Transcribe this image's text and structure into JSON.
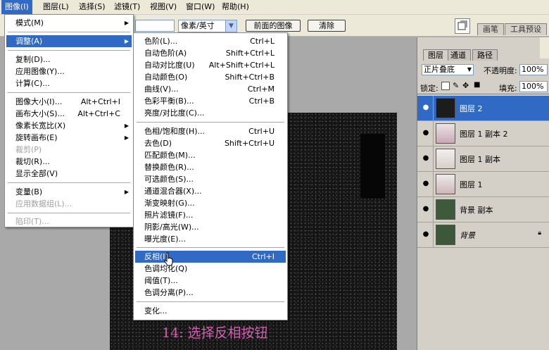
{
  "menubar": {
    "items": [
      {
        "label": "图像(I)"
      },
      {
        "label": "图层(L)"
      },
      {
        "label": "选择(S)"
      },
      {
        "label": "滤镜(T)"
      },
      {
        "label": "视图(V)"
      },
      {
        "label": "窗口(W)"
      },
      {
        "label": "帮助(H)"
      }
    ]
  },
  "options_bar": {
    "unit_select": "像素/英寸",
    "front_image_button": "前面的图像",
    "clear_button": "清除",
    "palette_tabs": [
      "画笔",
      "工具预设"
    ]
  },
  "image_menu": {
    "items": [
      {
        "label": "模式(M)",
        "shortcut": "",
        "submenu": true,
        "disabled": false
      },
      {
        "label": "调整(A)",
        "shortcut": "",
        "submenu": true,
        "disabled": false,
        "highlighted": true
      },
      {
        "label": "复制(D)...",
        "shortcut": "",
        "disabled": false
      },
      {
        "label": "应用图像(Y)...",
        "shortcut": "",
        "disabled": false
      },
      {
        "label": "计算(C)...",
        "shortcut": "",
        "disabled": false
      },
      {
        "label": "图像大小(I)...",
        "shortcut": "Alt+Ctrl+I",
        "disabled": false
      },
      {
        "label": "画布大小(S)...",
        "shortcut": "Alt+Ctrl+C",
        "disabled": false
      },
      {
        "label": "像素长宽比(X)",
        "shortcut": "",
        "submenu": true,
        "disabled": false
      },
      {
        "label": "旋转画布(E)",
        "shortcut": "",
        "submenu": true,
        "disabled": false
      },
      {
        "label": "裁剪(P)",
        "shortcut": "",
        "disabled": true
      },
      {
        "label": "裁切(R)...",
        "shortcut": "",
        "disabled": false
      },
      {
        "label": "显示全部(V)",
        "shortcut": "",
        "disabled": false
      },
      {
        "label": "变量(B)",
        "shortcut": "",
        "submenu": true,
        "disabled": false
      },
      {
        "label": "应用数据组(L)...",
        "shortcut": "",
        "disabled": true
      },
      {
        "label": "陷印(T)...",
        "shortcut": "",
        "disabled": true
      }
    ]
  },
  "adjust_menu": {
    "items": [
      {
        "label": "色阶(L)...",
        "shortcut": "Ctrl+L"
      },
      {
        "label": "自动色阶(A)",
        "shortcut": "Shift+Ctrl+L"
      },
      {
        "label": "自动对比度(U)",
        "shortcut": "Alt+Shift+Ctrl+L"
      },
      {
        "label": "自动颜色(O)",
        "shortcut": "Shift+Ctrl+B"
      },
      {
        "label": "曲线(V)...",
        "shortcut": "Ctrl+M"
      },
      {
        "label": "色彩平衡(B)...",
        "shortcut": "Ctrl+B"
      },
      {
        "label": "亮度/对比度(C)...",
        "shortcut": ""
      },
      {
        "label": "色相/饱和度(H)...",
        "shortcut": "Ctrl+U"
      },
      {
        "label": "去色(D)",
        "shortcut": "Shift+Ctrl+U"
      },
      {
        "label": "匹配颜色(M)...",
        "shortcut": ""
      },
      {
        "label": "替换颜色(R)...",
        "shortcut": ""
      },
      {
        "label": "可选颜色(S)...",
        "shortcut": ""
      },
      {
        "label": "通道混合器(X)...",
        "shortcut": ""
      },
      {
        "label": "渐变映射(G)...",
        "shortcut": ""
      },
      {
        "label": "照片滤镜(F)...",
        "shortcut": ""
      },
      {
        "label": "阴影/高光(W)...",
        "shortcut": ""
      },
      {
        "label": "曝光度(E)...",
        "shortcut": ""
      },
      {
        "label": "反相(I)",
        "shortcut": "Ctrl+I",
        "highlighted": true
      },
      {
        "label": "色调均化(Q)",
        "shortcut": ""
      },
      {
        "label": "阈值(T)...",
        "shortcut": ""
      },
      {
        "label": "色调分离(P)...",
        "shortcut": ""
      },
      {
        "label": "变化...",
        "shortcut": ""
      }
    ]
  },
  "layers_panel": {
    "tabs": [
      "图层",
      "通道",
      "路径"
    ],
    "blend_mode": "正片叠底",
    "opacity_label": "不透明度:",
    "opacity_value": "100%",
    "lock_label": "锁定:",
    "fill_label": "填充:",
    "fill_value": "100%",
    "layers": [
      {
        "name": "图层 2",
        "active": true,
        "thumb_color": "#1c1c1c"
      },
      {
        "name": "图层 1 副本 2",
        "active": false,
        "thumb_color": "#c9a9b4"
      },
      {
        "name": "图层 1 副本",
        "active": false,
        "thumb_color": "#d8cfc8"
      },
      {
        "name": "图层 1",
        "active": false,
        "thumb_color": "#cdb6b9"
      },
      {
        "name": "背景 副本",
        "active": false,
        "thumb_color": "#3f5a3a"
      },
      {
        "name": "背景",
        "active": false,
        "thumb_color": "#3d5838",
        "locked": true
      }
    ]
  },
  "caption": "14: 选择反相按钮",
  "colors": {
    "highlight": "#316ac5",
    "caption": "#d35fb0",
    "menu_bg": "#ece9d8"
  }
}
